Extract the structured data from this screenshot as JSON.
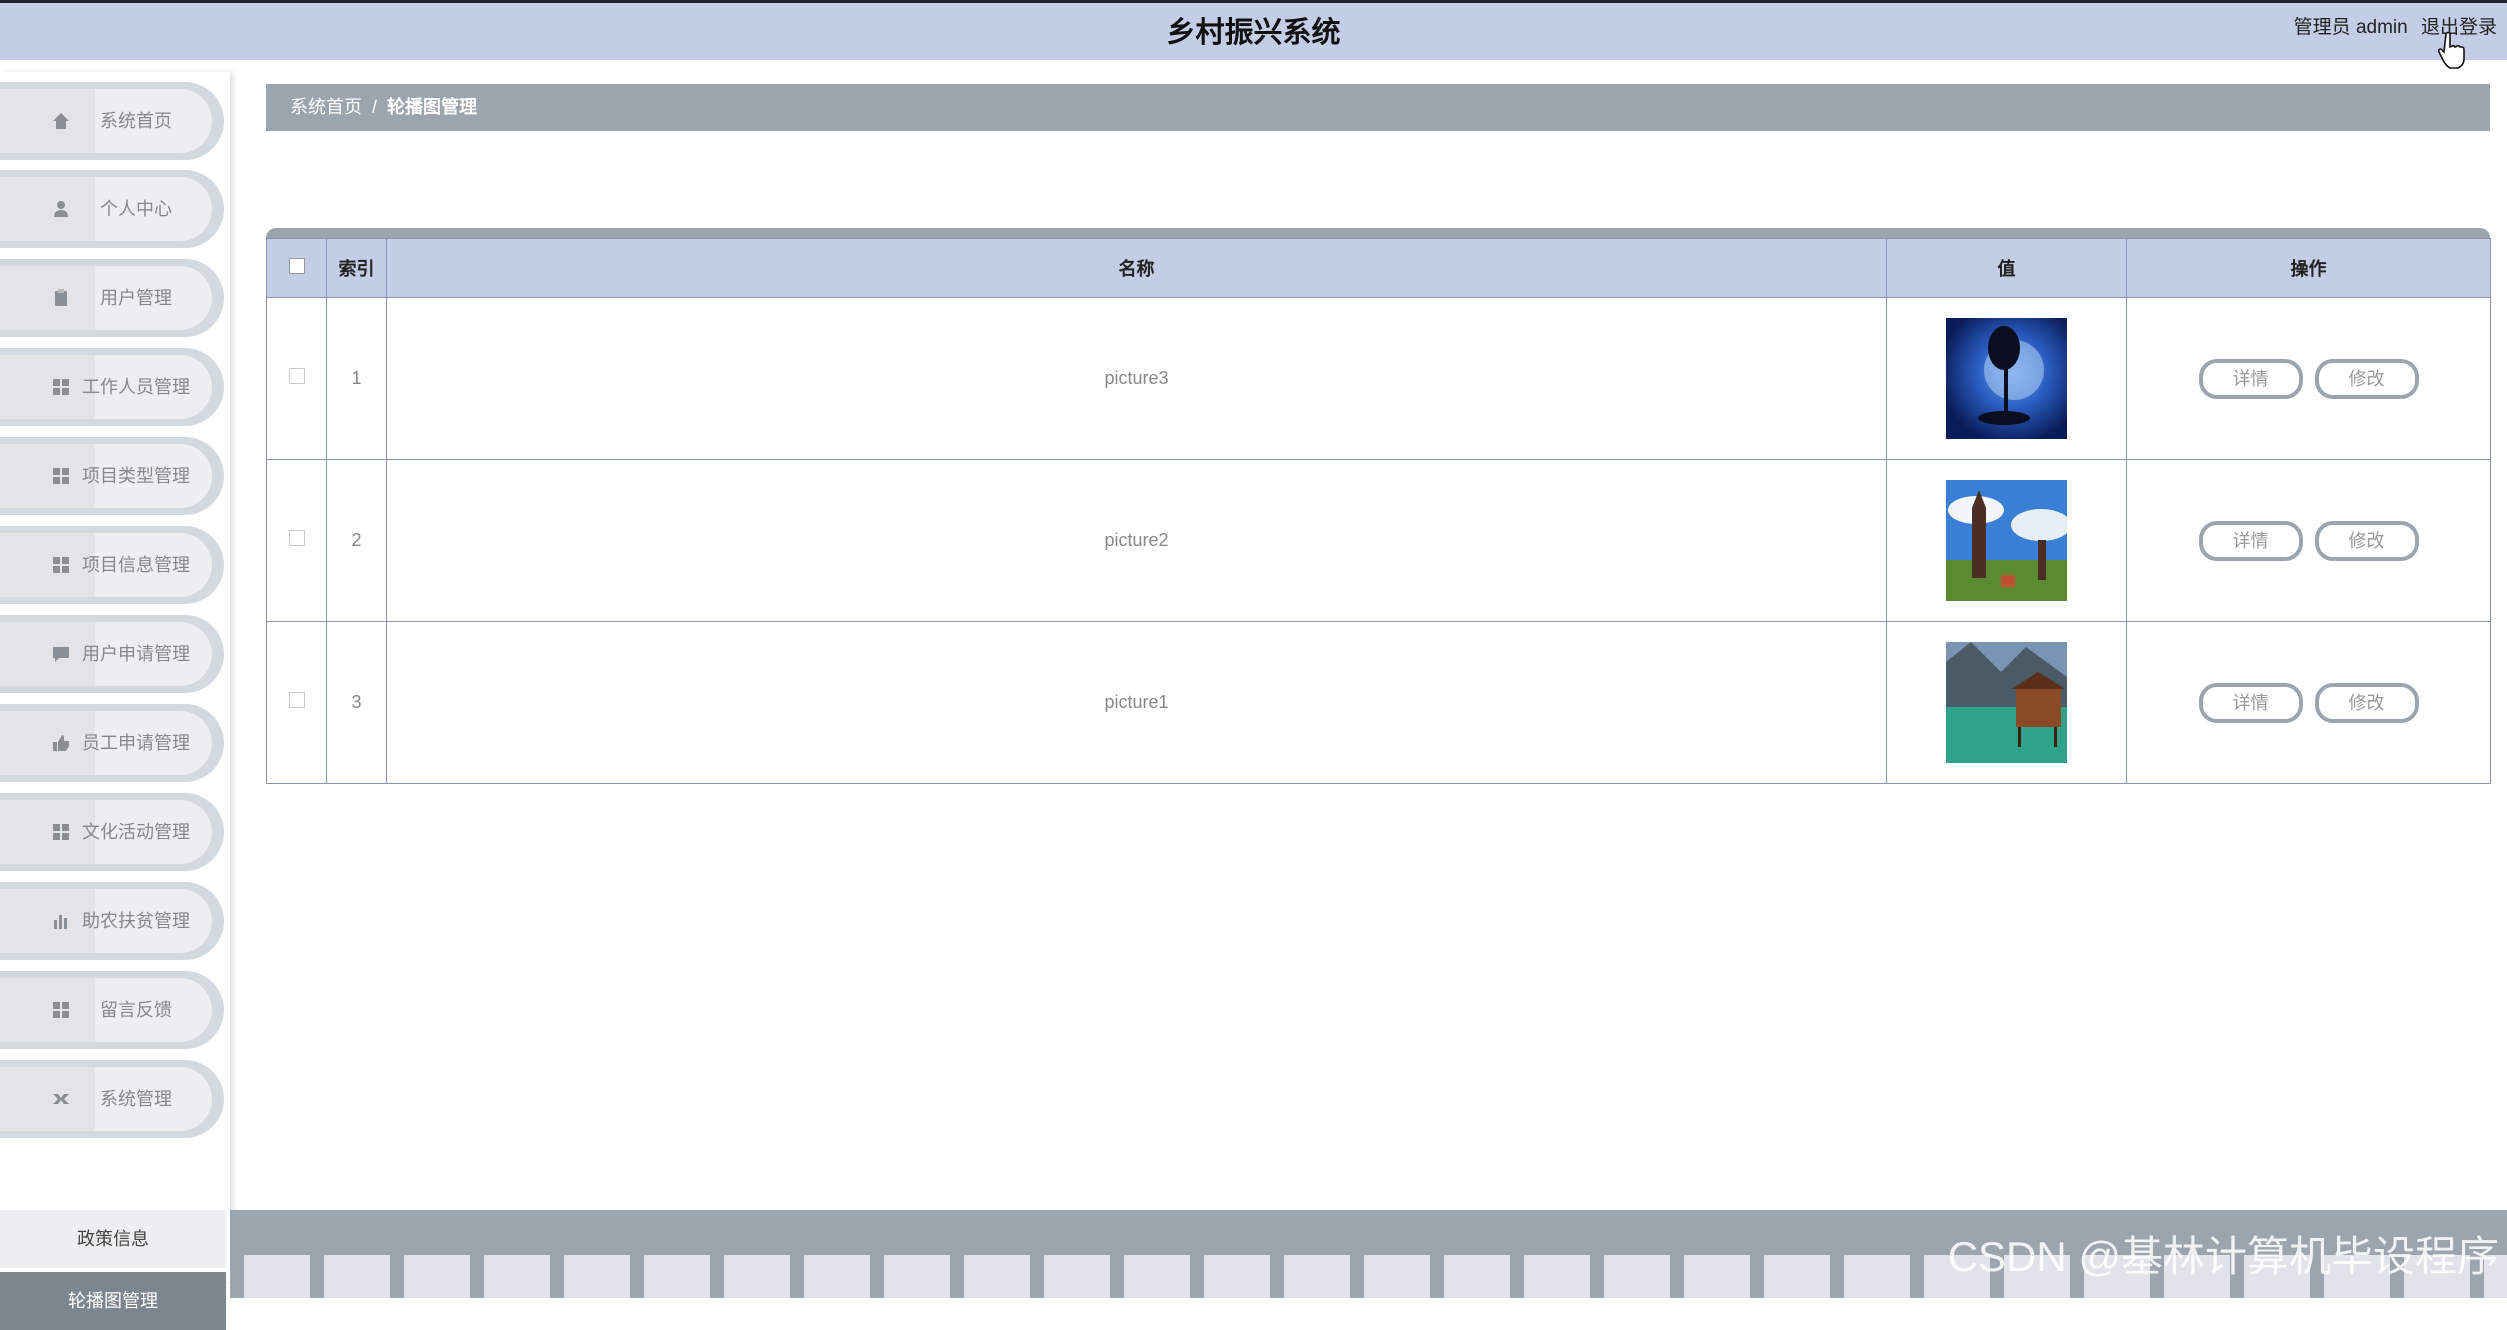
{
  "header": {
    "title": "乡村振兴系统",
    "user_label": "管理员 admin",
    "logout_label": "退出登录"
  },
  "sidebar": {
    "items": [
      {
        "label": "系统首页",
        "icon": "home-icon"
      },
      {
        "label": "个人中心",
        "icon": "person-icon"
      },
      {
        "label": "用户管理",
        "icon": "clipboard-icon"
      },
      {
        "label": "工作人员管理",
        "icon": "grid-icon"
      },
      {
        "label": "项目类型管理",
        "icon": "grid-icon"
      },
      {
        "label": "项目信息管理",
        "icon": "grid-icon"
      },
      {
        "label": "用户申请管理",
        "icon": "chat-icon"
      },
      {
        "label": "员工申请管理",
        "icon": "thumb-icon"
      },
      {
        "label": "文化活动管理",
        "icon": "grid-icon"
      },
      {
        "label": "助农扶贫管理",
        "icon": "bar-chart-icon"
      },
      {
        "label": "留言反馈",
        "icon": "grid-icon"
      },
      {
        "label": "系统管理",
        "icon": "settings-icon"
      }
    ],
    "submenu": [
      {
        "label": "政策信息"
      },
      {
        "label": "轮播图管理"
      }
    ]
  },
  "breadcrumb": {
    "home": "系统首页",
    "separator": "/",
    "current": "轮播图管理"
  },
  "table": {
    "headers": [
      "索引",
      "名称",
      "值",
      "操作"
    ],
    "rows": [
      {
        "index": "1",
        "name": "picture3",
        "image": "night-tree-moon"
      },
      {
        "index": "2",
        "name": "picture2",
        "image": "ruined-towers-sky"
      },
      {
        "index": "3",
        "name": "picture1",
        "image": "lake-cabin-mountains"
      }
    ],
    "detail_label": "详情",
    "edit_label": "修改"
  },
  "footer": {
    "watermark": "CSDN @基林计算机毕设程序"
  },
  "colors": {
    "header_bg": "#c3cde6",
    "accent_gray": "#9ca5ae",
    "active_submenu": "#7d858f"
  }
}
